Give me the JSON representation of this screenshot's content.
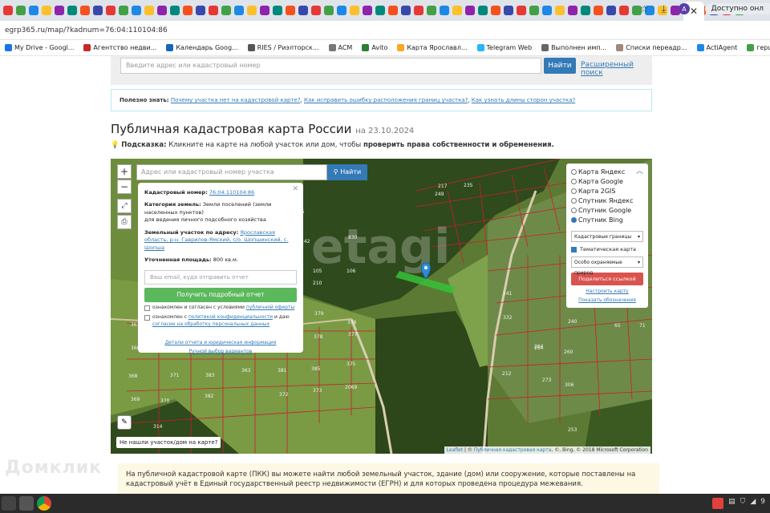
{
  "browser": {
    "address": "egrp365.ru/map/?kadnum=76:04:110104:86",
    "available_label": "Доступно онл",
    "profile_letter": "A",
    "bookmarks": [
      "My Drive - Googl...",
      "Агентство недви...",
      "Календарь Goog...",
      "RIES / Риэлторск...",
      "ACM",
      "Avito",
      "Карта Ярославл...",
      "Telegram Web",
      "Выполнен имп...",
      "Списки переадр...",
      "ActiAgent",
      "герцена - Купить..."
    ]
  },
  "search": {
    "placeholder": "Введите адрес или кадастровый номер",
    "button": "Найти",
    "advanced": "Расширенный поиск"
  },
  "info": {
    "prefix": "Полезно знать:",
    "links": [
      "Почему участка нет на кадастровой карте?",
      "Как исправить ошибку расположения границ участка?",
      "Как узнать длины сторон участка?"
    ]
  },
  "heading": {
    "title": "Публичная кадастровая карта России",
    "date": "на 23.10.2024"
  },
  "hint": {
    "label": "Подсказка:",
    "text": "Кликните на карте на любой участок или дом, чтобы",
    "bold": "проверить права собственности и обременения."
  },
  "map": {
    "search_placeholder": "Адрес или кадастровый номер участка",
    "find_button": "Найти",
    "not_found": "Не нашли участок/дом на карте?",
    "attribution_link1": "Leaflet",
    "attribution_link2": "Публичная кадастровая карта",
    "attribution_tail": "Bing, © 2018 Microsoft Corporation",
    "parcel_labels": [
      "297",
      "276",
      "276",
      "275",
      "145",
      "217",
      "249",
      "235",
      "274",
      "75",
      "242",
      "68",
      "317",
      "210",
      "105",
      "106",
      "830",
      "367",
      "366",
      "368",
      "369",
      "370",
      "371",
      "383",
      "382",
      "363",
      "381",
      "385",
      "373",
      "375",
      "376",
      "377",
      "379",
      "378",
      "372",
      "374",
      "314",
      "2069",
      "253",
      "65",
      "71",
      "240",
      "241",
      "332",
      "264",
      "260",
      "212",
      "273",
      "306",
      "264"
    ]
  },
  "popup": {
    "cad_label": "Кадастровый номер:",
    "cad_value": "76:04:110104:86",
    "cat_label": "Категория земель:",
    "cat_value": "Земли поселений (земли населенных пунктов)",
    "cat_use": "для ведения личного подсобного хозяйства",
    "addr_label": "Земельный участок по адресу:",
    "addr_value": "Ярославская область, р-н. Гаврилов-Ямский, с/о. Шопшинский, с. Шопша",
    "area_label": "Уточненная площадь:",
    "area_value": "800 кв.м.",
    "email_placeholder": "Ваш email, куда отправить отчет",
    "report_button": "Получить подробный отчет",
    "check1_text": "ознакомлен и согласен с условиями",
    "check1_link": "публичной оферты",
    "check2_text": "ознакомлен с",
    "check2_link": "политикой конфиденциальности",
    "check2_text2": "и даю",
    "check2_link2": "согласие на обработку персональных данных",
    "link_details": "Детали отчета и юридическая информация",
    "link_manual": "Ручной выбор вариантов"
  },
  "layers": {
    "options": [
      "Карта Яндекс",
      "Карта Google",
      "Карта 2GIS",
      "Спутник Яндекс",
      "Спутник Google",
      "Спутник Bing"
    ],
    "selected": "Спутник Bing",
    "select1": "Кадастровые границы",
    "thematic": "Тематическая карта",
    "select2": "Особо охраняемые природ",
    "share_button": "Поделиться ссылкой",
    "link_configure": "Настроить карту",
    "link_legend": "Показать обозначения"
  },
  "footer": {
    "text": "На публичной кадастровой карте (ПКК) вы можете найти любой земельный участок, здание (дом) или сооружение, которые поставлены на кадастровый учёт в Единый государственный реестр недвижимости (ЕГРН) и для которых проведена процедура межевания."
  },
  "watermark": "Домклик",
  "taskbar": {
    "tray_number": "9"
  }
}
